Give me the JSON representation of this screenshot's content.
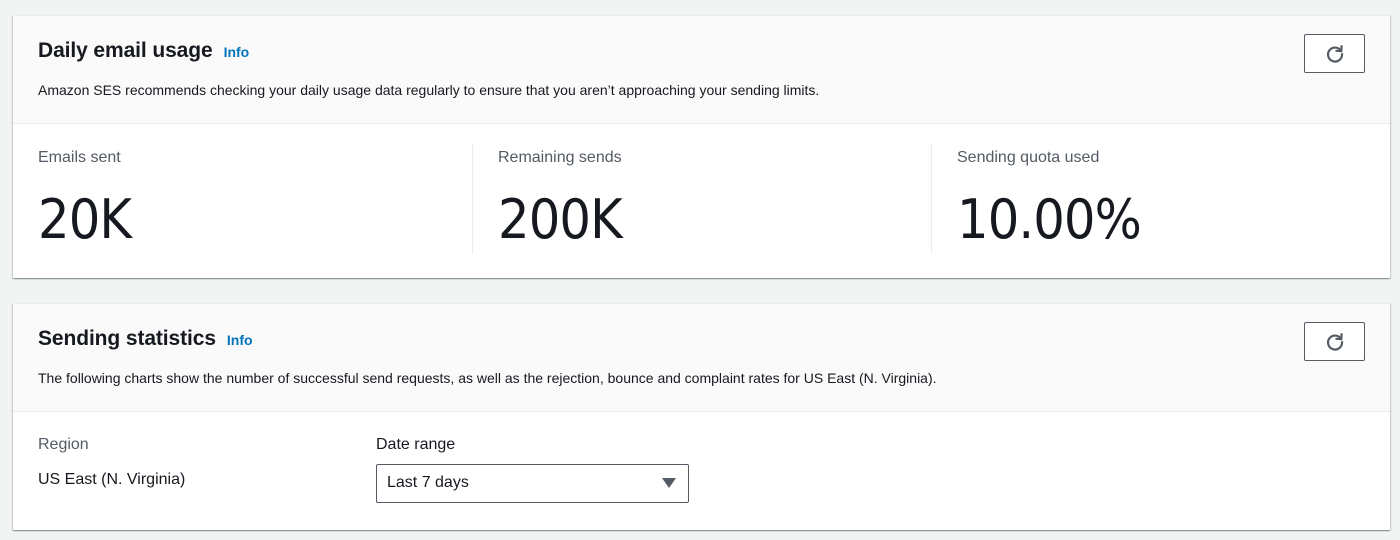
{
  "daily_usage": {
    "title": "Daily email usage",
    "info_label": "Info",
    "description": "Amazon SES recommends checking your daily usage data regularly to ensure that you aren’t approaching your sending limits.",
    "refresh_icon": "refresh-icon",
    "metrics": [
      {
        "label": "Emails sent",
        "value": "20K"
      },
      {
        "label": "Remaining sends",
        "value": "200K"
      },
      {
        "label": "Sending quota used",
        "value": "10.00%"
      }
    ]
  },
  "sending_statistics": {
    "title": "Sending statistics",
    "info_label": "Info",
    "description": "The following charts show the number of successful send requests, as well as the rejection, bounce and complaint rates for US East (N. Virginia).",
    "refresh_icon": "refresh-icon",
    "region_label": "Region",
    "region_value": "US East (N. Virginia)",
    "date_range_label": "Date range",
    "date_range_selected": "Last 7 days",
    "caret_icon": "caret-down-icon"
  },
  "colors": {
    "link": "#0073bb",
    "text": "#16191f",
    "muted": "#545b64",
    "background": "#f2f3f3",
    "header_bg": "#fafafa"
  }
}
